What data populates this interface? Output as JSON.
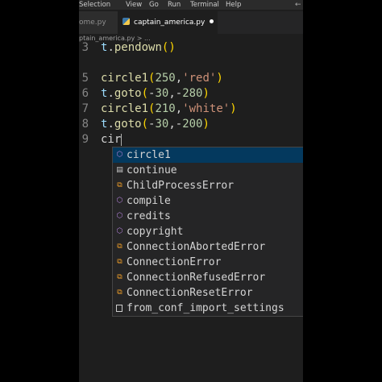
{
  "menu": {
    "items": [
      "Selection",
      "View",
      "Go",
      "Run",
      "Terminal",
      "Help"
    ],
    "back_arrow": "←"
  },
  "tabs": {
    "inactive_label": "ome.py",
    "active_label": "captain_america.py"
  },
  "breadcrumb": "ptain_america.py > ...",
  "code_lines": [
    {
      "num": "3",
      "text": "t.pendown()"
    },
    {
      "num": "5",
      "text": "circle1(250,'red')"
    },
    {
      "num": "6",
      "text": "t.goto(-30,-280)"
    },
    {
      "num": "7",
      "text": "circle1(210,'white')"
    },
    {
      "num": "8",
      "text": "t.goto(-30,-200)"
    },
    {
      "num": "9",
      "text": "cir"
    }
  ],
  "suggestions": [
    {
      "label": "circle1",
      "icon": "function-icon",
      "selected": true
    },
    {
      "label": "continue",
      "icon": "keyword-icon"
    },
    {
      "label": "ChildProcessError",
      "icon": "class-icon"
    },
    {
      "label": "compile",
      "icon": "function-icon"
    },
    {
      "label": "credits",
      "icon": "function-icon"
    },
    {
      "label": "copyright",
      "icon": "function-icon"
    },
    {
      "label": "ConnectionAbortedError",
      "icon": "class-icon"
    },
    {
      "label": "ConnectionError",
      "icon": "class-icon"
    },
    {
      "label": "ConnectionRefusedError",
      "icon": "class-icon"
    },
    {
      "label": "ConnectionResetError",
      "icon": "class-icon"
    },
    {
      "label": "from_conf_import_settings",
      "icon": "file-icon"
    }
  ],
  "colors": {
    "editor_bg": "#1e1e1e",
    "selected_suggestion": "#04395e",
    "function_icon": "#b180d7",
    "class_icon": "#ee9d28",
    "string": "#ce9178",
    "number": "#b5cea8",
    "function_name": "#dcdcaa"
  }
}
